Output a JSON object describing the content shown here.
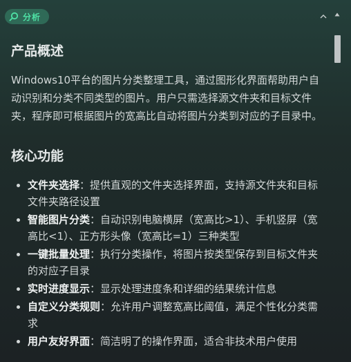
{
  "header": {
    "tag_label": "分析",
    "tag_icon": "search-icon",
    "collapse_icon": "chevron-up-icon",
    "accent_color": "#4fe3a6"
  },
  "overview": {
    "heading": "产品概述",
    "text": "Windows10平台的图片分类整理工具，通过图形化界面帮助用户自动识别和分类不同类型的图片。用户只需选择源文件夹和目标文件夹，程序即可根据图片的宽高比自动将图片分类到对应的子目录中。"
  },
  "core": {
    "heading": "核心功能",
    "items": [
      {
        "term": "文件夹选择",
        "sep": "：",
        "desc": "提供直观的文件夹选择界面，支持源文件夹和目标文件夹路径设置"
      },
      {
        "term": "智能图片分类",
        "sep": "：",
        "desc": "自动识别电脑横屏（宽高比>1）、手机竖屏（宽高比<1）、正方形头像（宽高比=1）三种类型"
      },
      {
        "term": "一键批量处理",
        "sep": "：",
        "desc": "执行分类操作，将图片按类型保存到目标文件夹的对应子目录"
      },
      {
        "term": "实时进度显示",
        "sep": "：",
        "desc": "显示处理进度条和详细的结果统计信息"
      },
      {
        "term": "自定义分类规则",
        "sep": "：",
        "desc": "允许用户调整宽高比阈值，满足个性化分类需求"
      },
      {
        "term": "用户友好界面",
        "sep": "：",
        "desc": "简洁明了的操作界面，适合非技术用户使用"
      }
    ]
  }
}
